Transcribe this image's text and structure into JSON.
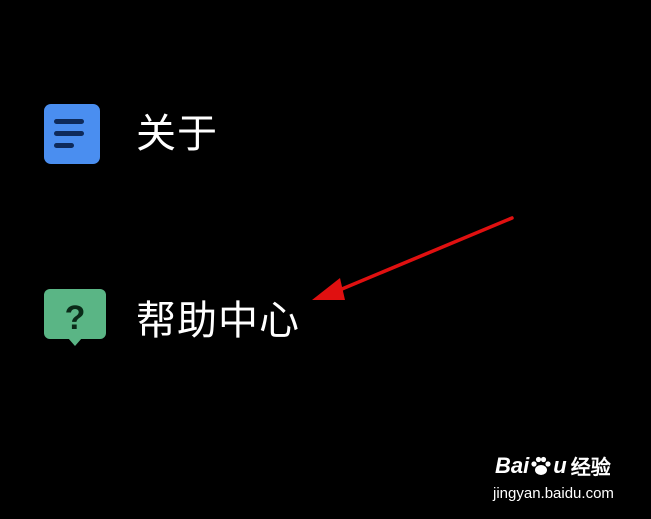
{
  "menu": {
    "items": [
      {
        "label": "关于",
        "icon": "document-lines-icon",
        "icon_color": "#4a8ef0"
      },
      {
        "label": "帮助中心",
        "icon": "question-bubble-icon",
        "icon_color": "#5ab585"
      }
    ]
  },
  "annotation": {
    "arrow_color": "#e01010"
  },
  "watermark": {
    "logo_left": "Bai",
    "logo_right": "u",
    "logo_suffix": "经验",
    "url": "jingyan.baidu.com"
  }
}
